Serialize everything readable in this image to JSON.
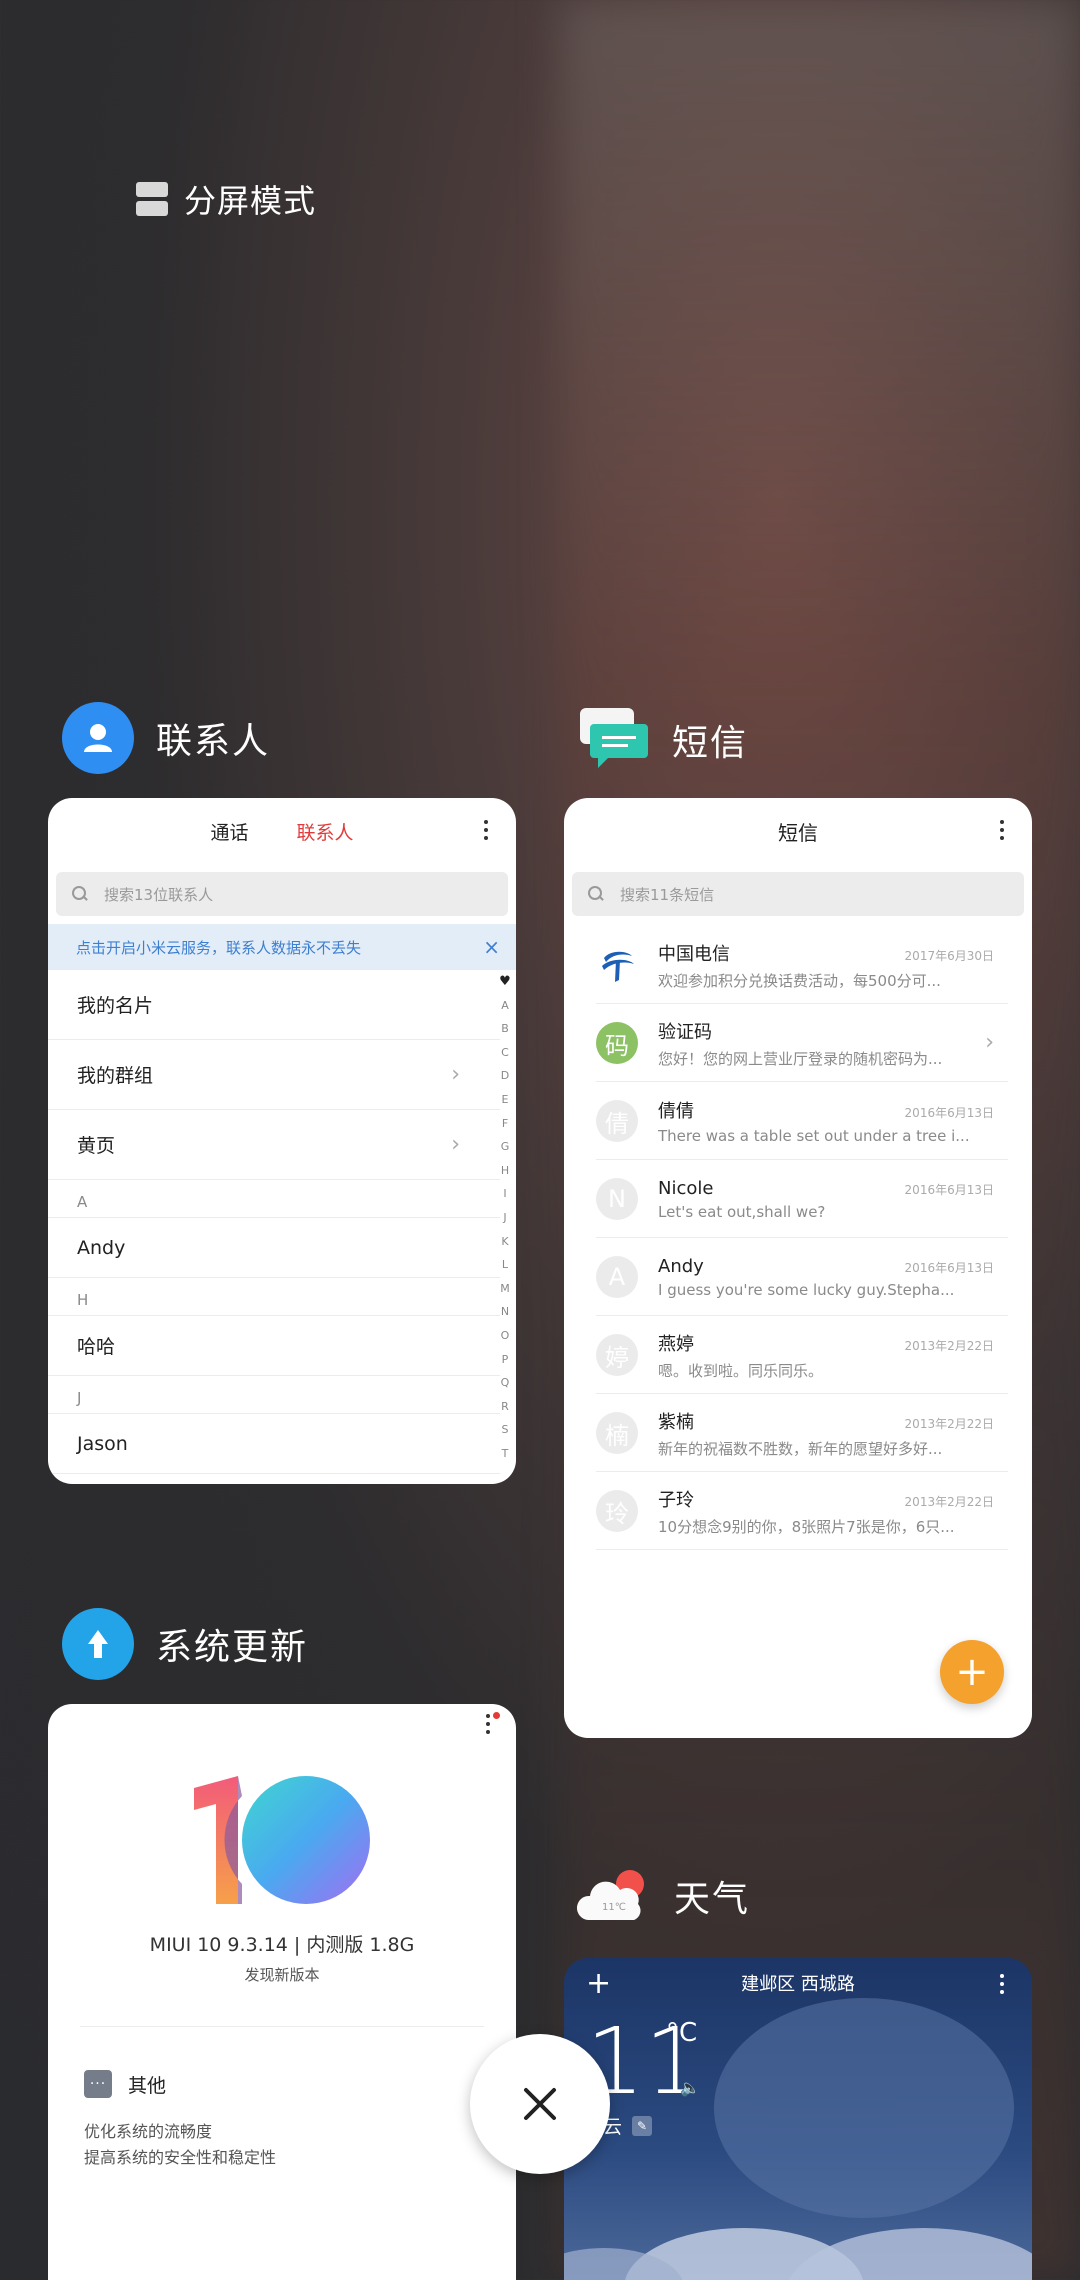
{
  "split_screen": {
    "label": "分屏模式"
  },
  "contacts": {
    "app_title": "联系人",
    "tabs": [
      "通话",
      "联系人"
    ],
    "active_tab": "联系人",
    "search_placeholder": "搜索13位联系人",
    "banner": "点击开启小米云服务，联系人数据永不丢失",
    "banner_close": "×",
    "rows": [
      {
        "kind": "row",
        "label": "我的名片"
      },
      {
        "kind": "row",
        "label": "我的群组",
        "chevron": "›"
      },
      {
        "kind": "row",
        "label": "黄页",
        "chevron": "›"
      },
      {
        "kind": "section",
        "label": "A"
      },
      {
        "kind": "row",
        "label": "Andy"
      },
      {
        "kind": "section",
        "label": "H"
      },
      {
        "kind": "row",
        "label": "哈哈"
      },
      {
        "kind": "section",
        "label": "J"
      },
      {
        "kind": "row",
        "label": "Jason"
      }
    ],
    "alphabet": [
      "♥",
      "A",
      "B",
      "C",
      "D",
      "E",
      "F",
      "G",
      "H",
      "I",
      "J",
      "K",
      "L",
      "M",
      "N",
      "O",
      "P",
      "Q",
      "R",
      "S",
      "T"
    ]
  },
  "messages": {
    "app_title": "短信",
    "header": "短信",
    "search_placeholder": "搜索11条短信",
    "items": [
      {
        "avatar": "",
        "avatar_color": "#ffffff",
        "name": "中国电信",
        "date": "2017年6月30日",
        "preview": "欢迎参加积分兑换话费活动，每500分可..."
      },
      {
        "avatar": "码",
        "avatar_color": "#8cc164",
        "name": "验证码",
        "date": "",
        "preview": "您好！您的网上营业厅登录的随机密码为...",
        "chevron": "›"
      },
      {
        "avatar": "倩",
        "avatar_color": "#ebebeb",
        "name": "倩倩",
        "date": "2016年6月13日",
        "preview": "There was a table set out under a tree i..."
      },
      {
        "avatar": "N",
        "avatar_color": "#ebebeb",
        "name": "Nicole",
        "date": "2016年6月13日",
        "preview": "Let's eat out,shall we?"
      },
      {
        "avatar": "A",
        "avatar_color": "#ebebeb",
        "name": "Andy",
        "date": "2016年6月13日",
        "preview": "I guess you're some lucky guy.Stepha..."
      },
      {
        "avatar": "婷",
        "avatar_color": "#ebebeb",
        "name": "燕婷",
        "date": "2013年2月22日",
        "preview": "嗯。收到啦。同乐同乐。"
      },
      {
        "avatar": "楠",
        "avatar_color": "#ebebeb",
        "name": "紫楠",
        "date": "2013年2月22日",
        "preview": "新年的祝福数不胜数，新年的愿望好多好..."
      },
      {
        "avatar": "玲",
        "avatar_color": "#ebebeb",
        "name": "子玲",
        "date": "2013年2月22日",
        "preview": "10分想念9别的你，8张照片7张是你，6只..."
      }
    ],
    "fab": "+"
  },
  "update": {
    "app_title": "系统更新",
    "version": "MIUI 10 9.3.14 | 内测版 1.8G",
    "status": "发现新版本",
    "section_icon": "···",
    "section_title": "其他",
    "lines": [
      "优化系统的流畅度",
      "提高系统的安全性和稳定性"
    ]
  },
  "weather": {
    "app_title": "天气",
    "icon_temp": "11℃",
    "location": "建邺区 西城路",
    "plus": "+",
    "temperature": "11",
    "unit": "°C",
    "speaker": "🔈",
    "condition": "多云",
    "edit": "✎"
  },
  "colors": {
    "accent_red": "#e03c3c",
    "link_blue": "#3d7fd0",
    "contacts_icon": "#2f8ef2",
    "messages_icon": "#2fc6b0",
    "update_icon": "#23a3e8",
    "fab_orange": "#f4a12e"
  }
}
